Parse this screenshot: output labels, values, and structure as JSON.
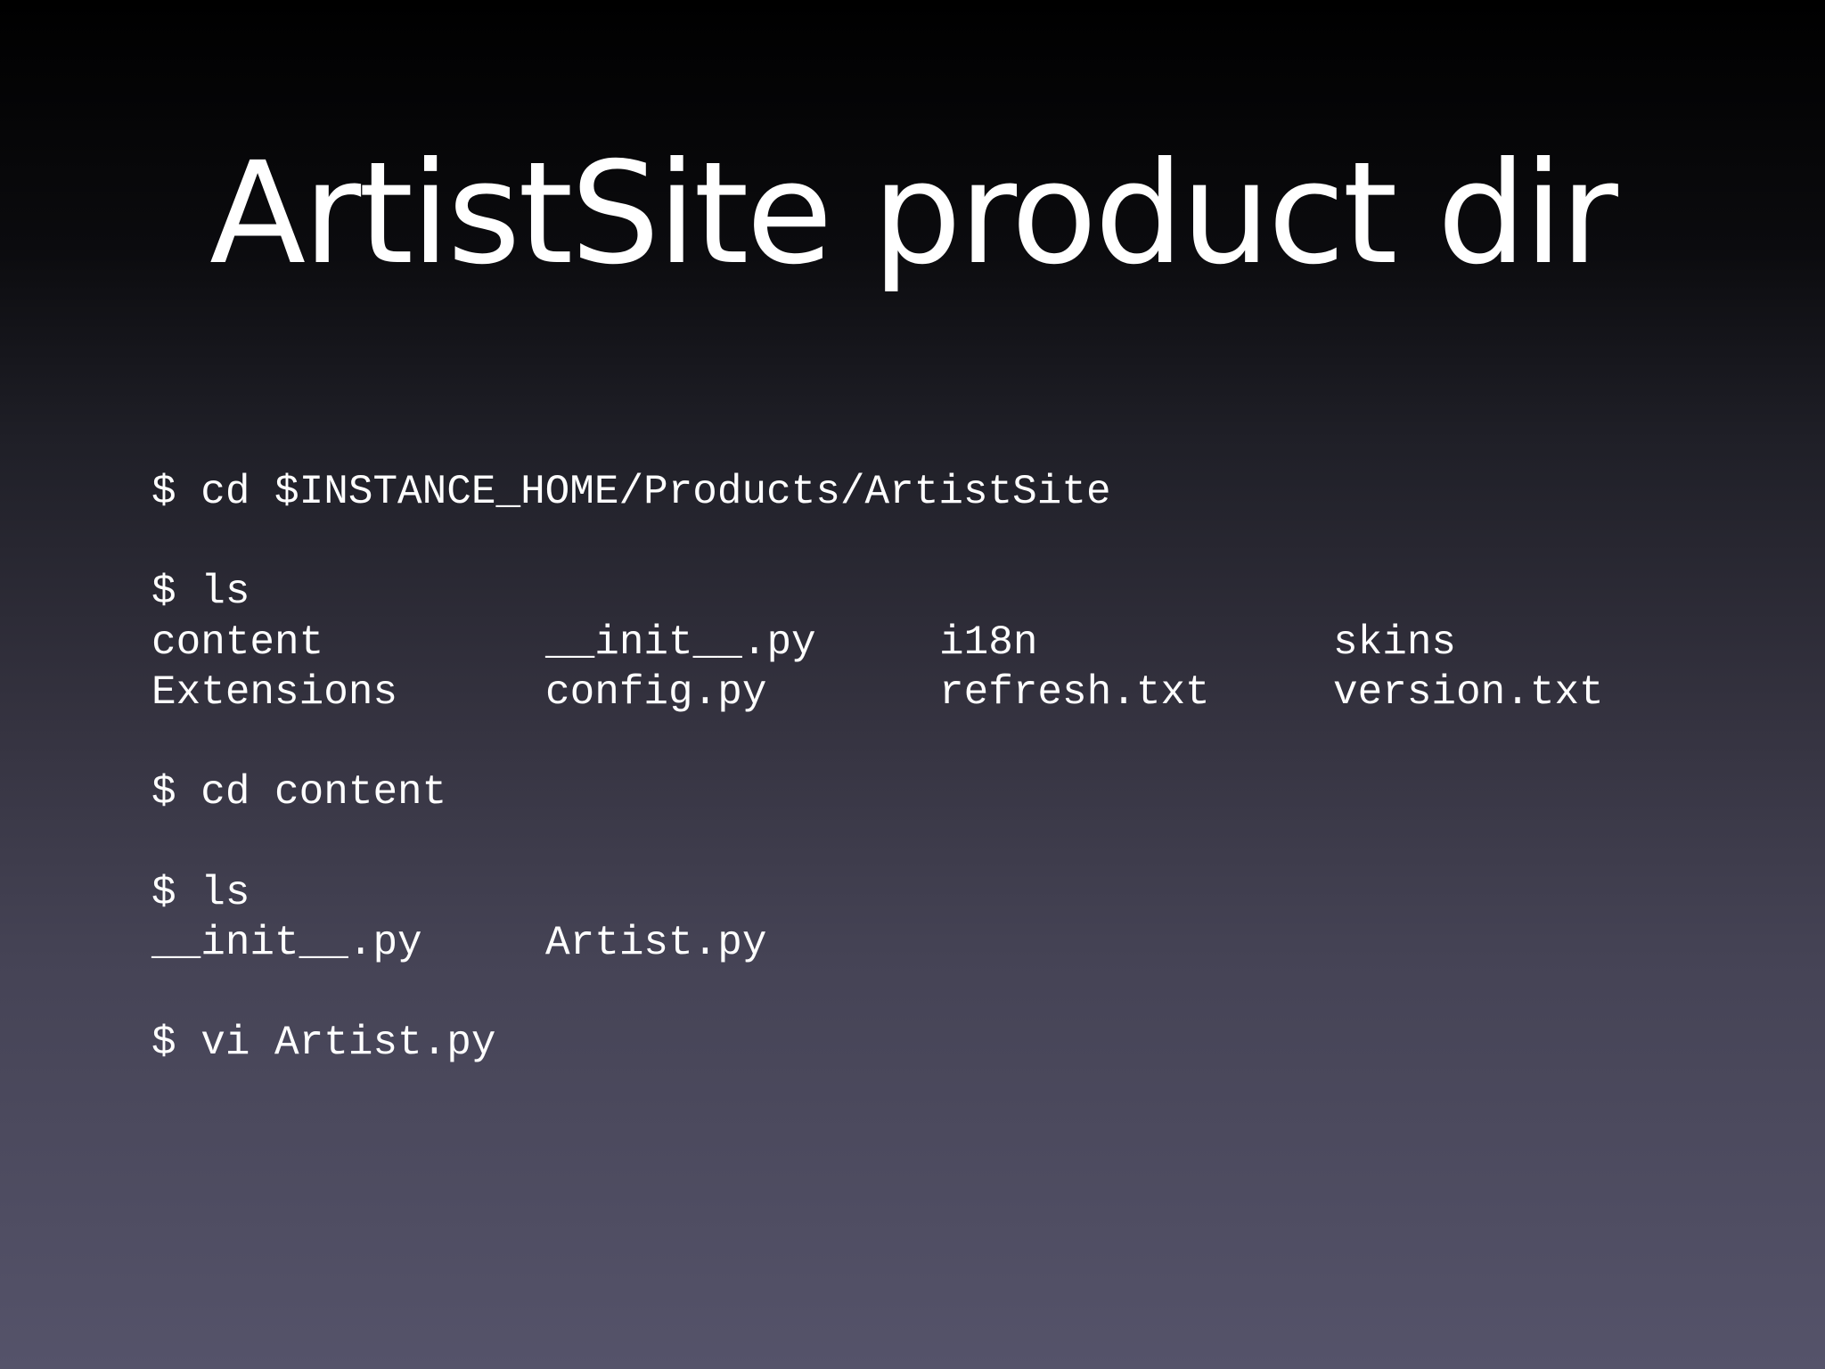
{
  "slide": {
    "title": "ArtistSite product dir"
  },
  "terminal": {
    "cmd1": "$ cd $INSTANCE_HOME/Products/ArtistSite",
    "cmd2": "$ ls",
    "listing1": [
      [
        "content",
        "__init__.py",
        "i18n",
        "skins"
      ],
      [
        "Extensions",
        "config.py",
        "refresh.txt",
        "version.txt"
      ]
    ],
    "cmd3": "$ cd content",
    "cmd4": "$ ls",
    "listing2": [
      [
        "__init__.py",
        "Artist.py"
      ]
    ],
    "cmd5": "$ vi Artist.py"
  }
}
